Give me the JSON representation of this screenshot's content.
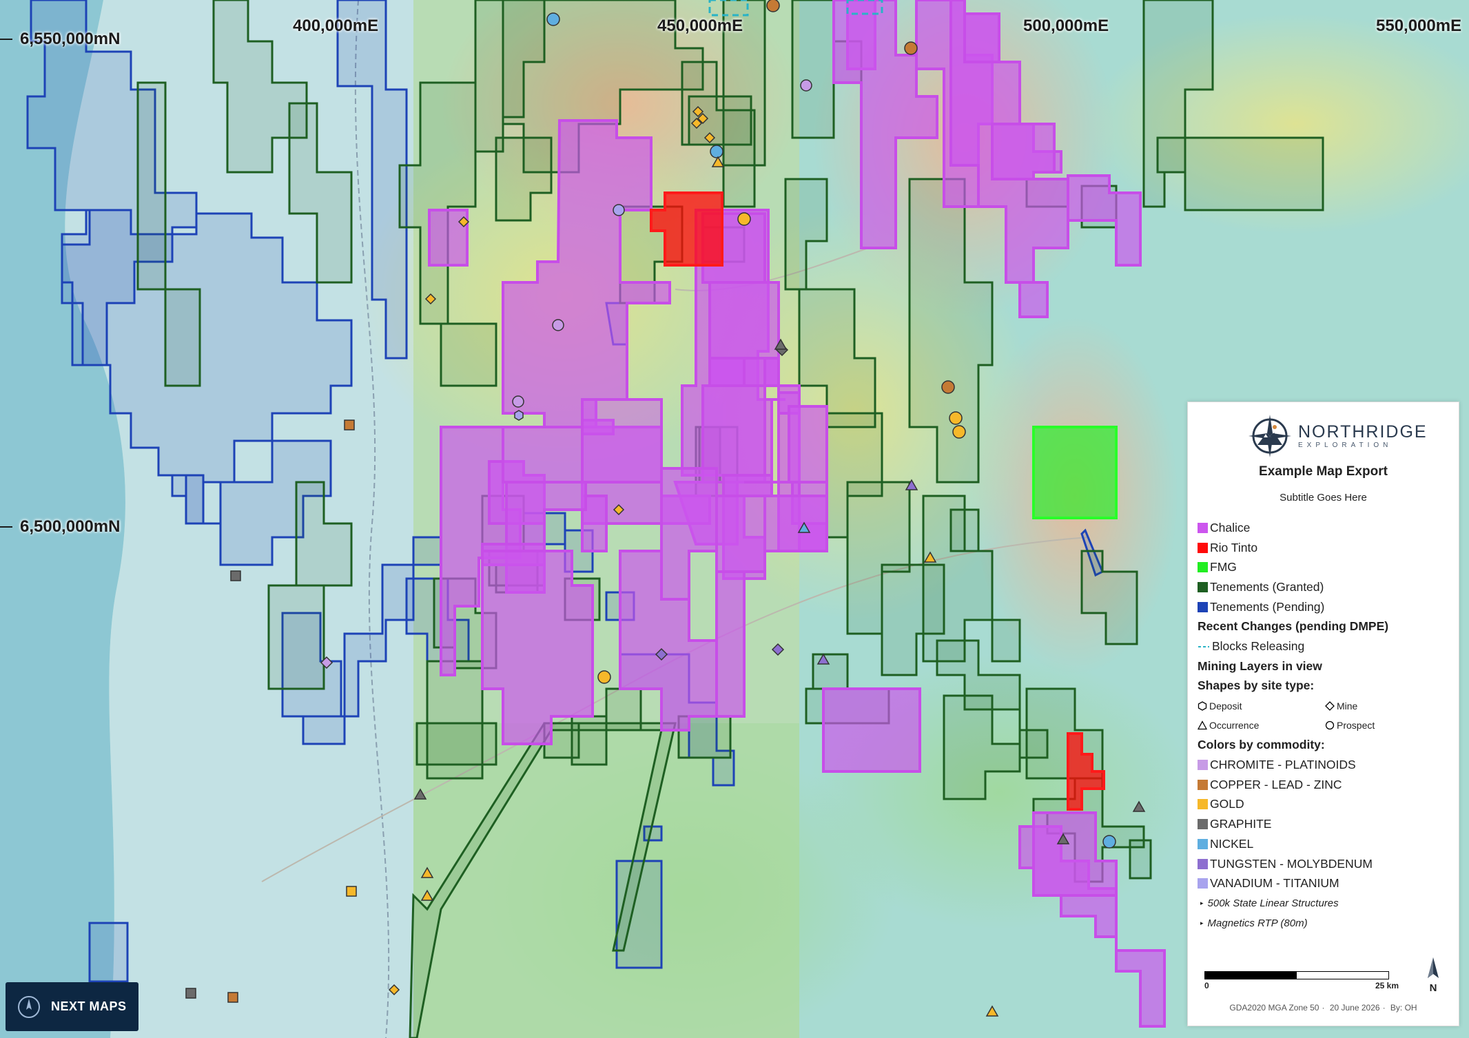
{
  "grid": {
    "eastings": [
      "400,000mE",
      "450,000mE",
      "500,000mE",
      "550,000mE"
    ],
    "northings": [
      "6,550,000mN",
      "6,500,000mN"
    ]
  },
  "legend": {
    "logo_name": "NORTHRIDGE",
    "logo_sub": "EXPLORATION",
    "title": "Example Map Export",
    "subtitle": "Subtitle Goes Here",
    "companies": [
      {
        "label": "Chalice",
        "color": "#cc55ee"
      },
      {
        "label": "Rio Tinto",
        "color": "#ff0a0a"
      },
      {
        "label": "FMG",
        "color": "#22ee22"
      },
      {
        "label": "Tenements (Granted)",
        "color": "#1e5f22"
      },
      {
        "label": "Tenements (Pending)",
        "color": "#1d43b6"
      }
    ],
    "recent_changes_heading": "Recent Changes (pending DMPE)",
    "blocks_releasing": {
      "label": "Blocks Releasing",
      "color": "#29b3c6"
    },
    "mining_layers_heading": "Mining Layers in view",
    "shapes_heading": "Shapes by site type:",
    "site_types": [
      {
        "label": "Deposit",
        "shape": "hexagon"
      },
      {
        "label": "Mine",
        "shape": "diamond"
      },
      {
        "label": "Occurrence",
        "shape": "triangle"
      },
      {
        "label": "Prospect",
        "shape": "circle"
      }
    ],
    "colors_heading": "Colors by commodity:",
    "commodities": [
      {
        "label": "CHROMITE - PLATINOIDS",
        "color": "#c79be6"
      },
      {
        "label": "COPPER - LEAD - ZINC",
        "color": "#c57a35"
      },
      {
        "label": "GOLD",
        "color": "#f6b82a"
      },
      {
        "label": "GRAPHITE",
        "color": "#6b6b6b"
      },
      {
        "label": "NICKEL",
        "color": "#5faee0"
      },
      {
        "label": "TUNGSTEN - MOLYBDENUM",
        "color": "#8d6fd0"
      },
      {
        "label": "VANADIUM - TITANIUM",
        "color": "#a8a3ee"
      }
    ],
    "extra_layers": [
      "500k State Linear Structures",
      "Magnetics RTP (80m)"
    ],
    "scale_zero": "0",
    "scale_end": "25 km",
    "north": "N",
    "footer": {
      "crs": "GDA2020 MGA Zone 50",
      "date": "20 June 2026",
      "by": "By: OH"
    }
  },
  "badge": {
    "label": "NEXT MAPS"
  },
  "colors": {
    "ocean": "#8cc8d2",
    "land": "#b4d9dc"
  }
}
